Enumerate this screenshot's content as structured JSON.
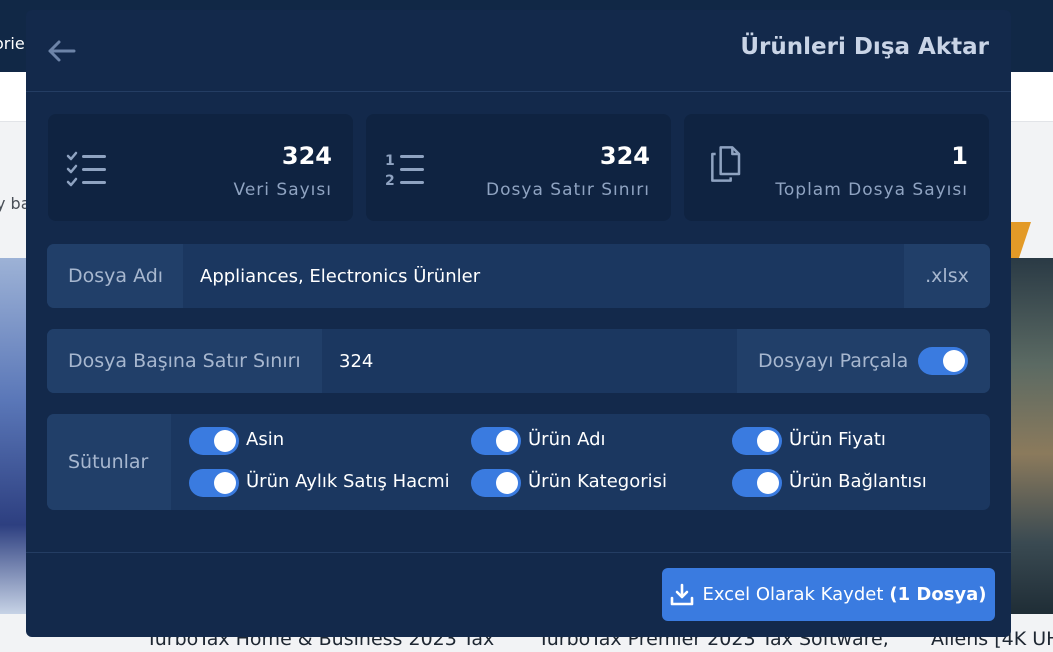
{
  "background": {
    "topbar_fragment": "orie",
    "side_fragment": "y ba",
    "bottom_titles": [
      "TurboTax Home & Business 2023 Tax",
      "TurboTax Premier 2023 Tax Software,",
      "Aliens [4K UH"
    ]
  },
  "modal": {
    "title": "Ürünleri Dışa Aktar",
    "stats": [
      {
        "value": "324",
        "label": "Veri Sayısı",
        "icon": "checklist-icon"
      },
      {
        "value": "324",
        "label": "Dosya Satır Sınırı",
        "icon": "numbered-list-icon"
      },
      {
        "value": "1",
        "label": "Toplam Dosya Sayısı",
        "icon": "copy-files-icon"
      }
    ],
    "file_name": {
      "label": "Dosya Adı",
      "value": "Appliances, Electronics Ürünler",
      "suffix": ".xlsx"
    },
    "row_limit": {
      "label": "Dosya Başına Satır Sınırı",
      "value": "324",
      "split_label": "Dosyayı Parçala",
      "split_on": true
    },
    "columns": {
      "label": "Sütunlar",
      "items": [
        {
          "label": "Asin",
          "on": true
        },
        {
          "label": "Ürün Adı",
          "on": true
        },
        {
          "label": "Ürün Fiyatı",
          "on": true
        },
        {
          "label": "Ürün Aylık Satış Hacmi",
          "on": true
        },
        {
          "label": "Ürün Kategorisi",
          "on": true
        },
        {
          "label": "Ürün Bağlantısı",
          "on": true
        }
      ]
    },
    "save_button": {
      "label": "Excel Olarak Kaydet",
      "count": "(1 Dosya)"
    },
    "colors": {
      "accent": "#3a7be0",
      "panel": "#13294b",
      "card": "#0f2341"
    }
  }
}
